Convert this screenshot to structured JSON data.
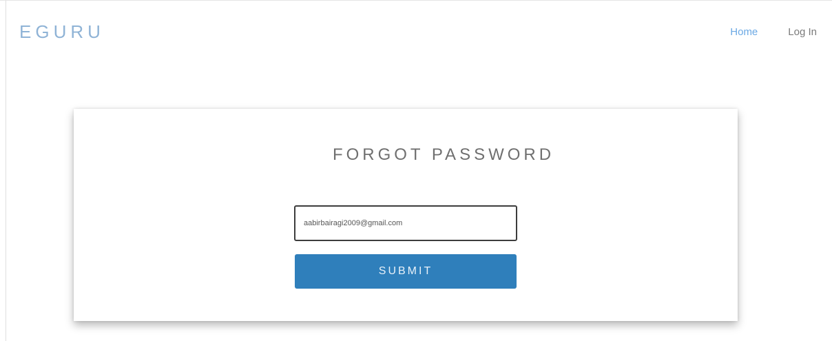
{
  "header": {
    "brand": "EGURU",
    "nav": {
      "home": "Home",
      "login": "Log In"
    }
  },
  "form": {
    "title": "FORGOT PASSWORD",
    "email_value": "aabirbairagi2009@gmail.com",
    "submit_label": "SUBMIT"
  },
  "colors": {
    "brand": "#8fb3d6",
    "nav_active": "#6aa8e4",
    "submit_bg": "#2f7fbb"
  }
}
